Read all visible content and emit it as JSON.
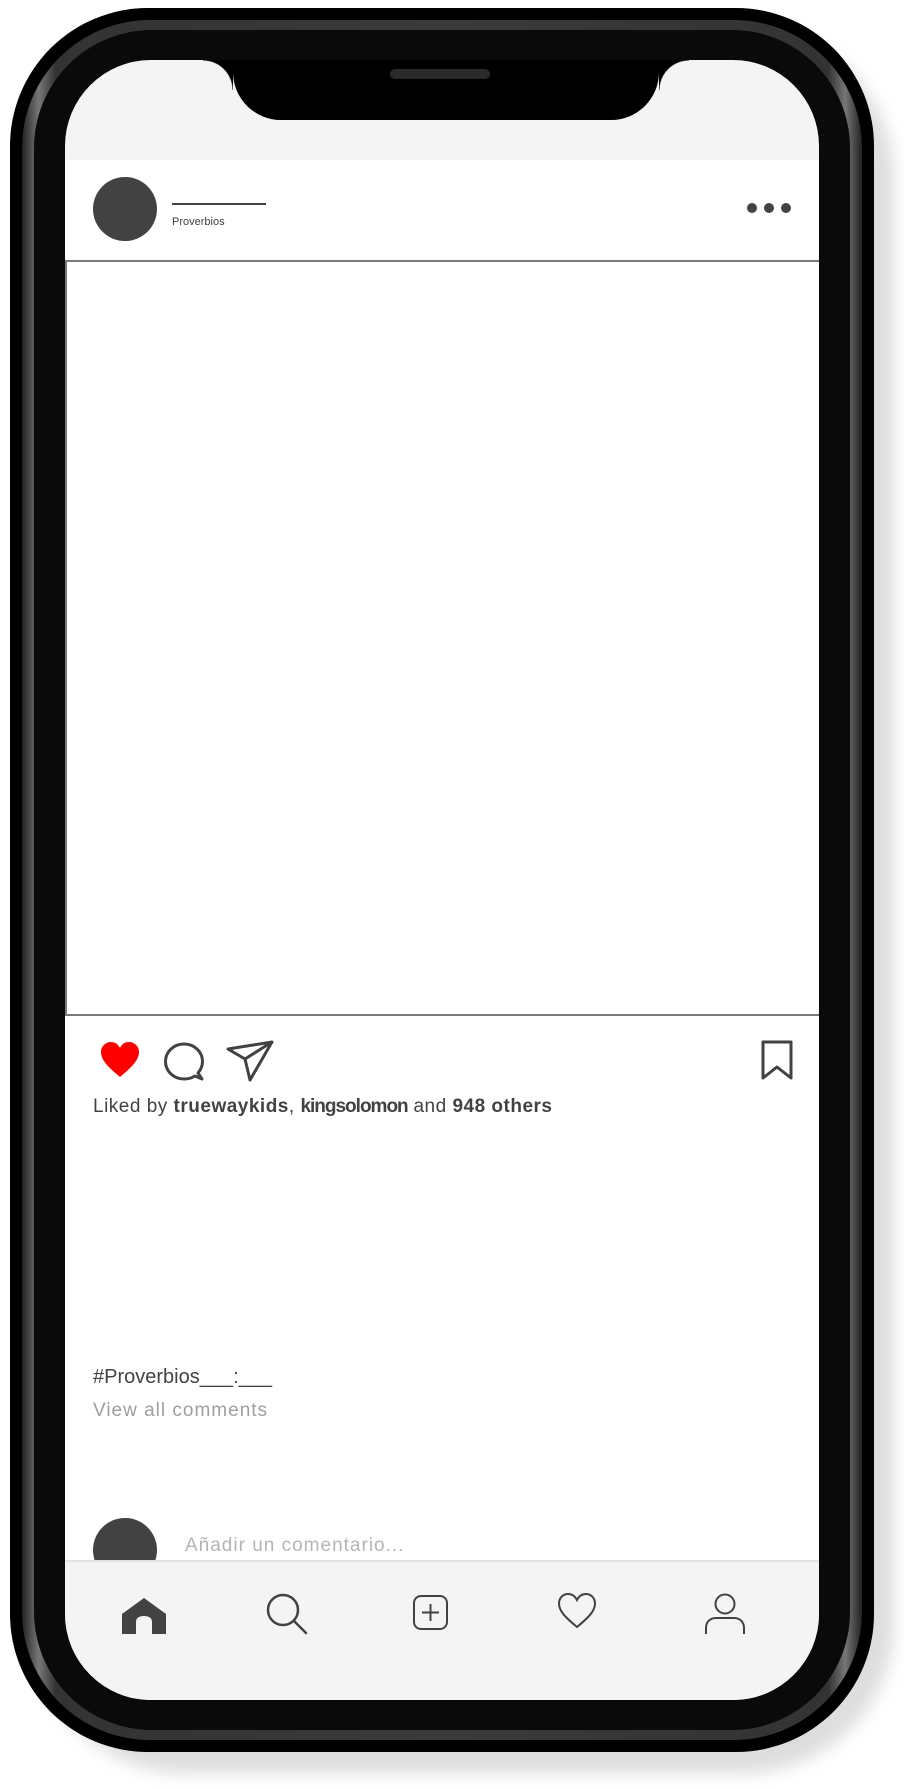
{
  "post": {
    "location": "Proverbios",
    "likes": {
      "prefix": "Liked by ",
      "user1": "truewaykids",
      "separator": ", ",
      "user2": "kingsolomon",
      "conjunction": " and ",
      "others": "948 others"
    },
    "caption": "#Proverbios___:___",
    "view_comments": "View all comments",
    "comment_placeholder": "Añadir un comentario...",
    "liked": true
  },
  "colors": {
    "like_red": "#ff0000",
    "icon_dark": "#424242",
    "muted_text": "#9e9e9e"
  },
  "icons": {
    "more": "more-dots-icon",
    "like": "heart-filled-icon",
    "comment": "speech-bubble-icon",
    "share": "paper-plane-icon",
    "bookmark": "bookmark-icon",
    "nav": [
      "home-icon",
      "search-icon",
      "add-post-icon",
      "heart-icon",
      "profile-icon"
    ]
  }
}
